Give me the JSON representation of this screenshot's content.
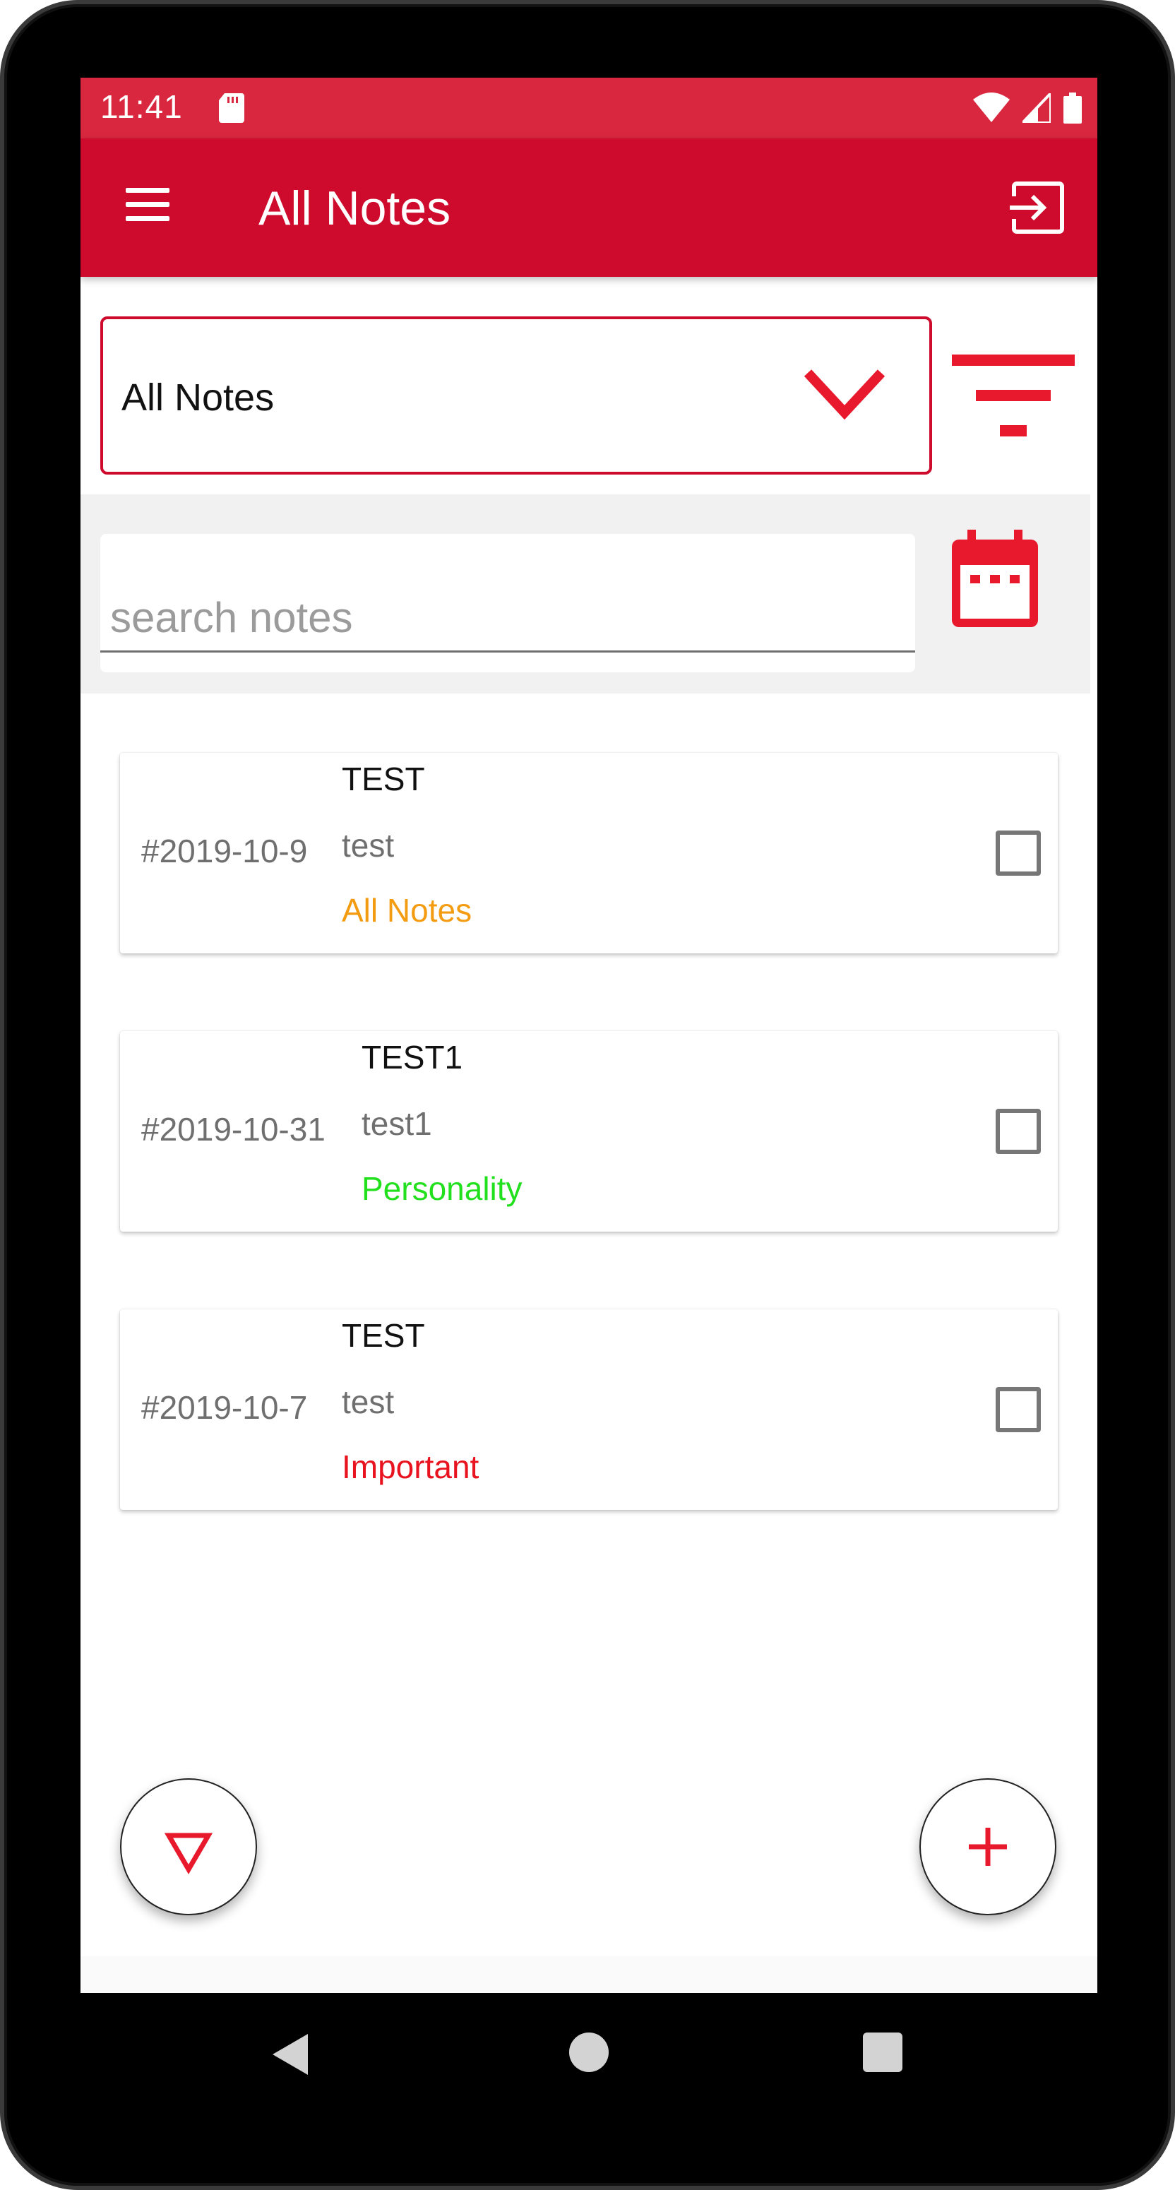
{
  "status_bar": {
    "time": "11:41"
  },
  "app_bar": {
    "title": "All Notes"
  },
  "filter": {
    "selected": "All Notes"
  },
  "search": {
    "placeholder": "search notes",
    "value": ""
  },
  "notes": [
    {
      "date": "#2019-10-9",
      "title": "TEST",
      "body": "test",
      "category": "All Notes",
      "category_color": "#f39c12",
      "checked": false
    },
    {
      "date": "#2019-10-31",
      "title": "TEST1",
      "body": "test1",
      "category": "Personality",
      "category_color": "#22e01e",
      "checked": false
    },
    {
      "date": "#2019-10-7",
      "title": "TEST",
      "body": "test",
      "category": "Important",
      "category_color": "#e8131f",
      "checked": false
    }
  ],
  "colors": {
    "status_bar": "#d9273f",
    "app_bar": "#cf0b2d",
    "accent": "#e8192c"
  },
  "icons": {
    "menu": "hamburger-menu-icon",
    "exit": "exit-to-app-icon",
    "dropdown": "chevron-down-icon",
    "filter": "filter-icon",
    "calendar": "calendar-icon",
    "sort": "triangle-down-icon",
    "add": "plus-icon"
  }
}
